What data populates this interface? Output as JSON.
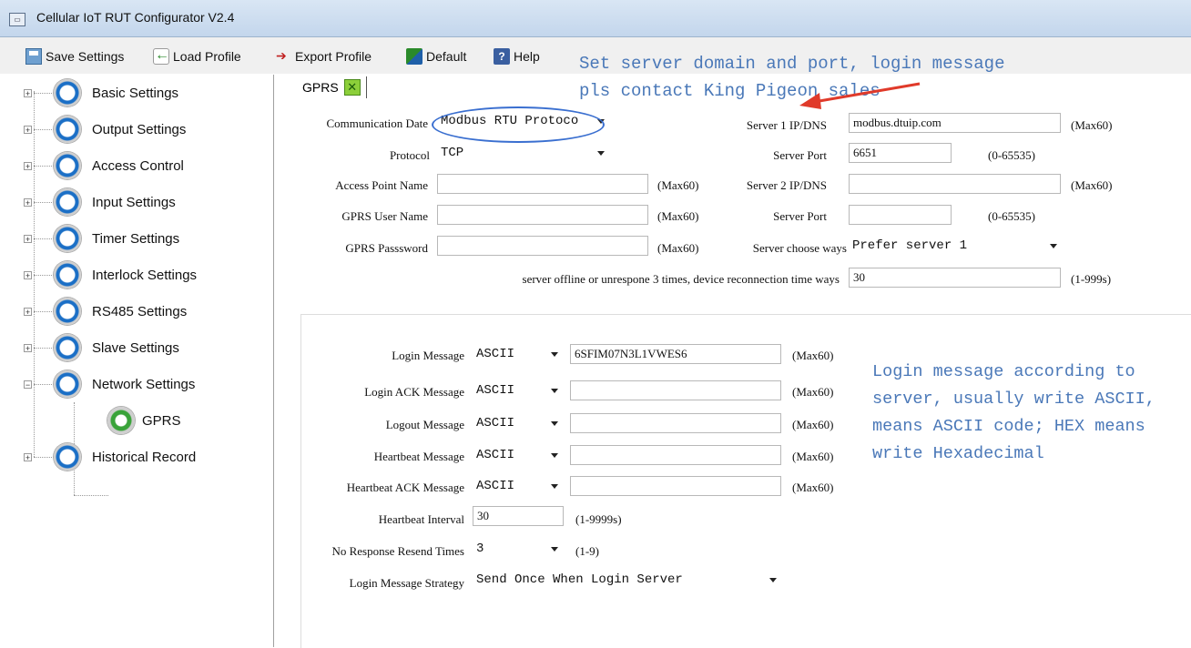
{
  "window": {
    "title": "Cellular IoT RUT Configurator V2.4"
  },
  "toolbar": {
    "save": "Save Settings",
    "load": "Load Profile",
    "export": "Export Profile",
    "default": "Default",
    "help": "Help"
  },
  "sidebar": {
    "items": [
      "Basic Settings",
      "Output Settings",
      "Access Control",
      "Input Settings",
      "Timer Settings",
      "Interlock Settings",
      "RS485 Settings",
      "Slave Settings",
      "Network Settings",
      "Historical Record"
    ],
    "child": "GPRS"
  },
  "tab": {
    "label": "GPRS"
  },
  "gprs": {
    "comm_label": "Communication Date",
    "comm_value": "Modbus RTU Protoco",
    "protocol_label": "Protocol",
    "protocol_value": "TCP",
    "apn_label": "Access Point Name",
    "apn_value": "",
    "apn_max": "(Max60)",
    "user_label": "GPRS  User Name",
    "user_value": "",
    "user_max": "(Max60)",
    "pass_label": "GPRS Passsword",
    "pass_value": "",
    "pass_max": "(Max60)",
    "server1_label": "Server 1 IP/DNS",
    "server1_value": "modbus.dtuip.com",
    "server1_max": "(Max60)",
    "port1_label": "Server Port",
    "port1_value": "6651",
    "port1_range": "(0-65535)",
    "server2_label": "Server 2 IP/DNS",
    "server2_value": "",
    "server2_max": "(Max60)",
    "port2_label": "Server Port",
    "port2_value": "",
    "port2_range": "(0-65535)",
    "choose_label": "Server choose ways",
    "choose_value": "Prefer server 1",
    "offline_label": "server offline or unrespone 3 times, device reconnection time ways",
    "offline_value": "30",
    "offline_range": "(1-999s)"
  },
  "login": {
    "rows": [
      {
        "label": "Login Message",
        "format": "ASCII",
        "value": "6SFIM07N3L1VWES6",
        "max": "(Max60)"
      },
      {
        "label": "Login ACK Message",
        "format": "ASCII",
        "value": "",
        "max": "(Max60)"
      },
      {
        "label": "Logout Message",
        "format": "ASCII",
        "value": "",
        "max": "(Max60)"
      },
      {
        "label": "Heartbeat Message",
        "format": "ASCII",
        "value": "",
        "max": "(Max60)"
      },
      {
        "label": "Heartbeat ACK Message",
        "format": "ASCII",
        "value": "",
        "max": "(Max60)"
      }
    ],
    "interval_label": "Heartbeat Interval",
    "interval_value": "30",
    "interval_range": "(1-9999s)",
    "resend_label": "No Response Resend Times",
    "resend_value": "3",
    "resend_range": "(1-9)",
    "strategy_label": "Login Message Strategy",
    "strategy_value": "Send Once When Login Server"
  },
  "annotations": {
    "top_line1": "Set server domain and port, login message",
    "top_line2": "pls contact King Pigeon sales",
    "right_line1": "Login message according to",
    "right_line2": "server, usually write ASCII,",
    "right_line3": "means ASCII code; HEX means",
    "right_line4": "write Hexadecimal"
  },
  "colors": {
    "annotation": "#4a78b8",
    "arrow": "#e03a2a",
    "oval": "#3a6fd0"
  }
}
